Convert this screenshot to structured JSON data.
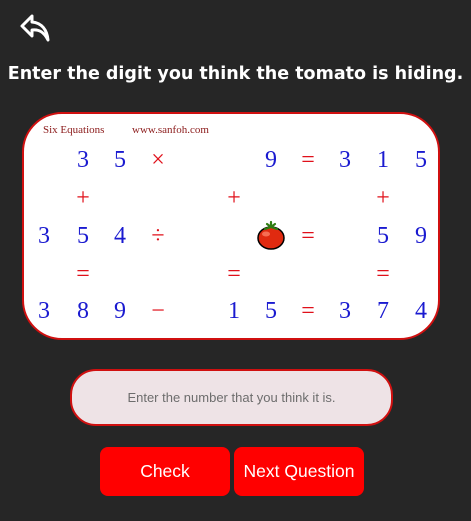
{
  "header": {
    "back_icon": "back-arrow-icon",
    "instruction": "Enter the digit you think the tomato is hiding."
  },
  "board": {
    "title": "Six Equations",
    "site": "www.sanfoh.com",
    "cells": [
      {
        "row": 0,
        "col": 1,
        "kind": "digit",
        "text": "3"
      },
      {
        "row": 0,
        "col": 2,
        "kind": "digit",
        "text": "5"
      },
      {
        "row": 0,
        "col": 3,
        "kind": "op",
        "text": "×"
      },
      {
        "row": 0,
        "col": 6,
        "kind": "digit",
        "text": "9"
      },
      {
        "row": 0,
        "col": 7,
        "kind": "op",
        "text": "="
      },
      {
        "row": 0,
        "col": 8,
        "kind": "digit",
        "text": "3"
      },
      {
        "row": 0,
        "col": 9,
        "kind": "digit",
        "text": "1"
      },
      {
        "row": 0,
        "col": 10,
        "kind": "digit",
        "text": "5"
      },
      {
        "row": 1,
        "col": 1,
        "kind": "op",
        "text": "+"
      },
      {
        "row": 1,
        "col": 5,
        "kind": "op",
        "text": "+"
      },
      {
        "row": 1,
        "col": 9,
        "kind": "op",
        "text": "+"
      },
      {
        "row": 2,
        "col": 0,
        "kind": "digit",
        "text": "3"
      },
      {
        "row": 2,
        "col": 1,
        "kind": "digit",
        "text": "5"
      },
      {
        "row": 2,
        "col": 2,
        "kind": "digit",
        "text": "4"
      },
      {
        "row": 2,
        "col": 3,
        "kind": "op",
        "text": "÷"
      },
      {
        "row": 2,
        "col": 6,
        "kind": "tomato",
        "text": ""
      },
      {
        "row": 2,
        "col": 7,
        "kind": "op",
        "text": "="
      },
      {
        "row": 2,
        "col": 9,
        "kind": "digit",
        "text": "5"
      },
      {
        "row": 2,
        "col": 10,
        "kind": "digit",
        "text": "9"
      },
      {
        "row": 3,
        "col": 1,
        "kind": "op",
        "text": "="
      },
      {
        "row": 3,
        "col": 5,
        "kind": "op",
        "text": "="
      },
      {
        "row": 3,
        "col": 9,
        "kind": "op",
        "text": "="
      },
      {
        "row": 4,
        "col": 0,
        "kind": "digit",
        "text": "3"
      },
      {
        "row": 4,
        "col": 1,
        "kind": "digit",
        "text": "8"
      },
      {
        "row": 4,
        "col": 2,
        "kind": "digit",
        "text": "9"
      },
      {
        "row": 4,
        "col": 3,
        "kind": "op",
        "text": "−"
      },
      {
        "row": 4,
        "col": 5,
        "kind": "digit",
        "text": "1"
      },
      {
        "row": 4,
        "col": 6,
        "kind": "digit",
        "text": "5"
      },
      {
        "row": 4,
        "col": 7,
        "kind": "op",
        "text": "="
      },
      {
        "row": 4,
        "col": 8,
        "kind": "digit",
        "text": "3"
      },
      {
        "row": 4,
        "col": 9,
        "kind": "digit",
        "text": "7"
      },
      {
        "row": 4,
        "col": 10,
        "kind": "digit",
        "text": "4"
      }
    ],
    "hidden_icon": "tomato-icon",
    "colors": {
      "digit": "#1a1ad0",
      "operator": "#e0101a",
      "border": "#d01010"
    }
  },
  "answer": {
    "placeholder": "Enter the number that you think it is.",
    "value": ""
  },
  "buttons": {
    "check_label": "Check",
    "next_label": "Next Question",
    "color": "#ff0000"
  }
}
